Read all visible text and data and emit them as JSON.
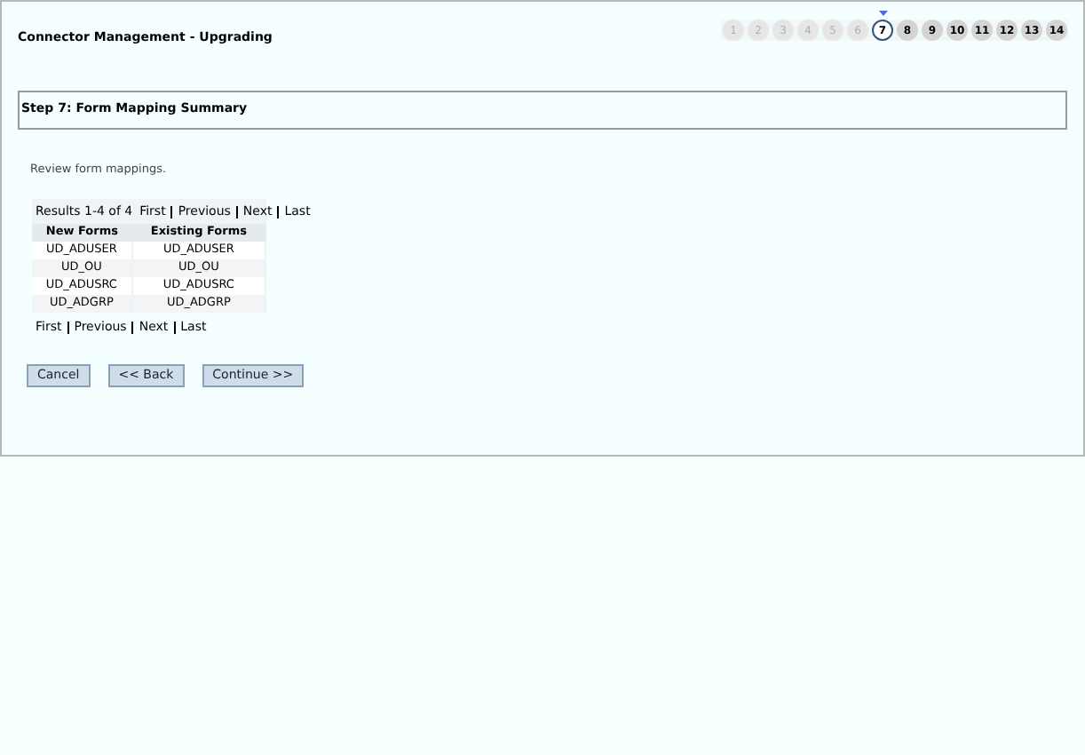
{
  "window": {
    "title": "Connector Management - Upgrading"
  },
  "steps": [
    {
      "label": "1",
      "selected": false,
      "disabled": true
    },
    {
      "label": "2",
      "selected": false,
      "disabled": true
    },
    {
      "label": "3",
      "selected": false,
      "disabled": true
    },
    {
      "label": "4",
      "selected": false,
      "disabled": true
    },
    {
      "label": "5",
      "selected": false,
      "disabled": true
    },
    {
      "label": "6",
      "selected": false,
      "disabled": true
    },
    {
      "label": "7",
      "selected": true,
      "disabled": false
    },
    {
      "label": "8",
      "selected": false,
      "disabled": false
    },
    {
      "label": "9",
      "selected": false,
      "disabled": false
    },
    {
      "label": "10",
      "selected": false,
      "disabled": false
    },
    {
      "label": "11",
      "selected": false,
      "disabled": false
    },
    {
      "label": "12",
      "selected": false,
      "disabled": false
    },
    {
      "label": "13",
      "selected": false,
      "disabled": false
    },
    {
      "label": "14",
      "selected": false,
      "disabled": false
    }
  ],
  "step_heading": "Step 7: Form Mapping Summary",
  "instruction": "Review form mappings.",
  "results": "Results 1-4 of 4",
  "pager_top": [
    "First",
    "Previous",
    "Next",
    "Last"
  ],
  "table": {
    "columns": [
      "New Forms",
      "Existing Forms"
    ],
    "rows": [
      [
        "UD_ADUSER",
        "UD_ADUSER"
      ],
      [
        "UD_OU",
        "UD_OU"
      ],
      [
        "UD_ADUSRC",
        "UD_ADUSRC"
      ],
      [
        "UD_ADGRP",
        "UD_ADGRP"
      ]
    ]
  },
  "pager_bottom": [
    "First",
    "Previous",
    "Next",
    "Last"
  ],
  "buttons": [
    "Cancel",
    "<< Back",
    "Continue >>"
  ]
}
